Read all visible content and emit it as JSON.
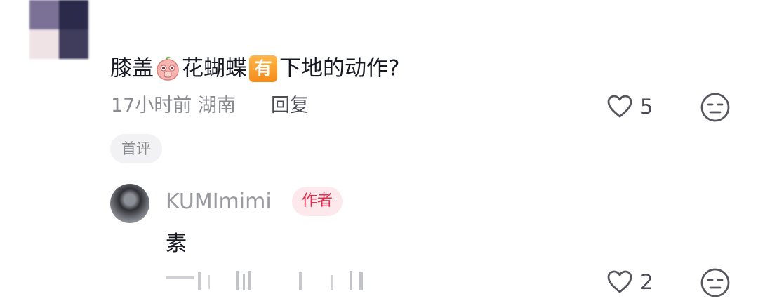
{
  "comment": {
    "text_before": "膝盖",
    "text_middle": "花蝴蝶",
    "badge": "有",
    "text_after": "下地的动作?",
    "meta": "17小时前 湖南",
    "reply_label": "回复",
    "likes": "5",
    "tag": "首评"
  },
  "reply": {
    "username": "KUMImimi",
    "author_badge": "作者",
    "text": "素",
    "likes": "2"
  },
  "icons": {
    "like": "heart-outline-icon",
    "dislike": "meh-face-icon",
    "emoji": "peach-face-emoji"
  },
  "colors": {
    "text": "#161823",
    "muted": "#8a8b91",
    "author_badge_bg": "#fde8ec",
    "author_badge_text": "#e0304d",
    "badge_orange": "#f38b1a"
  }
}
